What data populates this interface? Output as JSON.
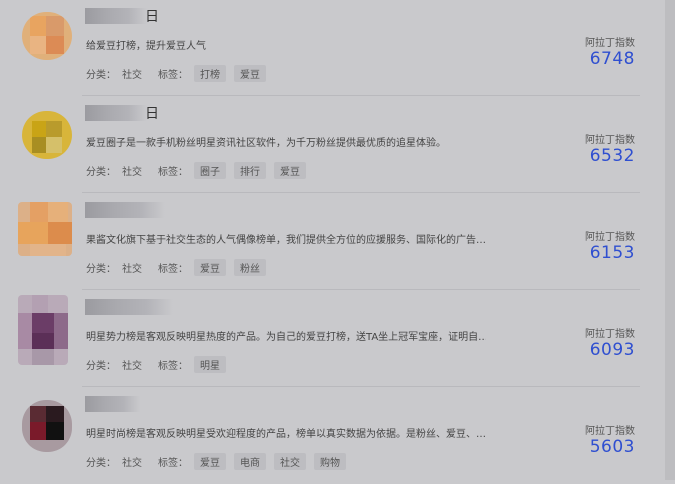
{
  "list": {
    "index_label": "阿拉丁指数",
    "category_label": "分类：",
    "tags_label": "标签：",
    "items": [
      {
        "title_visible": "日",
        "description": "给爱豆打榜，提升爱豆人气",
        "category": "社交",
        "tags": [
          "打榜",
          "爱豆"
        ],
        "index": "6748"
      },
      {
        "title_visible": "日",
        "description": "爱豆圈子是一款手机粉丝明星资讯社区软件，为千万粉丝提供最优质的追星体验。",
        "category": "社交",
        "tags": [
          "圈子",
          "排行",
          "爱豆"
        ],
        "index": "6532"
      },
      {
        "title_visible": "",
        "description": "果酱文化旗下基于社交生态的人气偶像榜单，我们提供全方位的应援服务、国际化的广告…",
        "category": "社交",
        "tags": [
          "爱豆",
          "粉丝"
        ],
        "index": "6153"
      },
      {
        "title_visible": "",
        "description": "明星势力榜是客观反映明星热度的产品。为自己的爱豆打榜，送TA坐上冠军宝座，证明自…",
        "category": "社交",
        "tags": [
          "明星"
        ],
        "index": "6093"
      },
      {
        "title_visible": "",
        "description": "明星时尚榜是客观反映明星受欢迎程度的产品，榜单以真实数据为依据。是粉丝、爱豆、…",
        "category": "社交",
        "tags": [
          "爱豆",
          "电商",
          "社交",
          "购物"
        ],
        "index": "5603"
      }
    ]
  }
}
